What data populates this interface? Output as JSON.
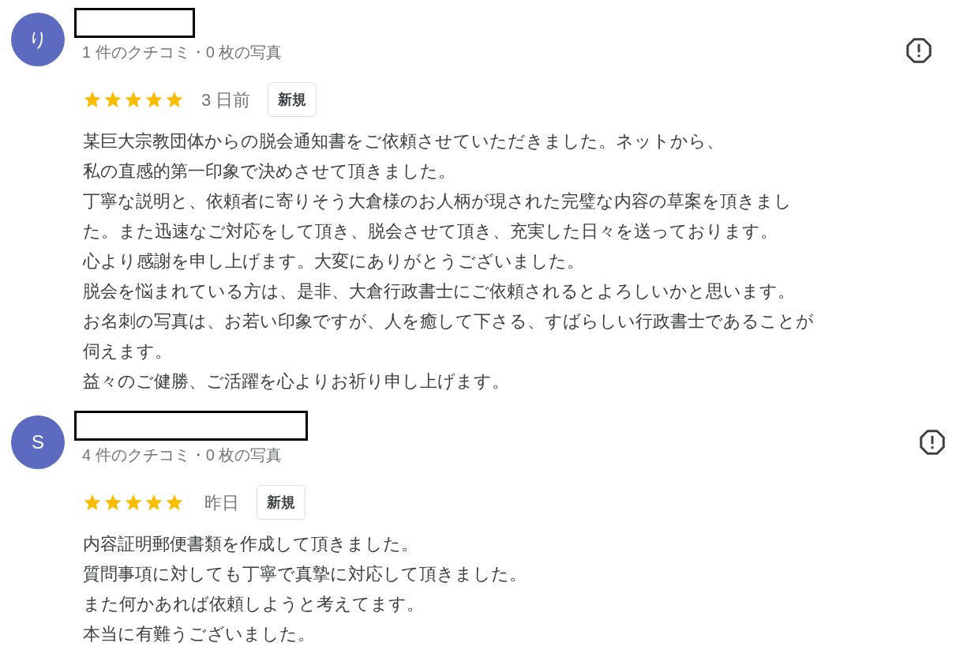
{
  "reviews": [
    {
      "avatar_letter": "り",
      "meta": "1 件のクチコミ・0 枚の写真",
      "stars": 5,
      "date": "3 日前",
      "badge": "新規",
      "lines": [
        "某巨大宗教団体からの脱会通知書をご依頼させていただきました。ネットから、",
        "私の直感的第一印象で決めさせて頂きました。",
        "丁寧な説明と、依頼者に寄りそう大倉様のお人柄が現された完璧な内容の草案を頂きまし",
        "た。また迅速なご対応をして頂き、脱会させて頂き、充実した日々を送っております。",
        "心より感謝を申し上げます。大変にありがとうございました。",
        "脱会を悩まれている方は、是非、大倉行政書士にご依頼されるとよろしいかと思います。",
        "お名刺の写真は、お若い印象ですが、人を癒して下さる、すばらしい行政書士であることが",
        "伺えます。",
        "益々のご健勝、ご活躍を心よりお祈り申し上げます。"
      ]
    },
    {
      "avatar_letter": "S",
      "meta": "4 件のクチコミ・0 枚の写真",
      "stars": 5,
      "date": "昨日",
      "badge": "新規",
      "lines": [
        "内容証明郵便書類を作成して頂きました。",
        "質問事項に対しても丁寧で真摯に対応して頂きました。",
        "また何かあれば依頼しようと考えてます。",
        "本当に有難うございました。"
      ]
    }
  ]
}
